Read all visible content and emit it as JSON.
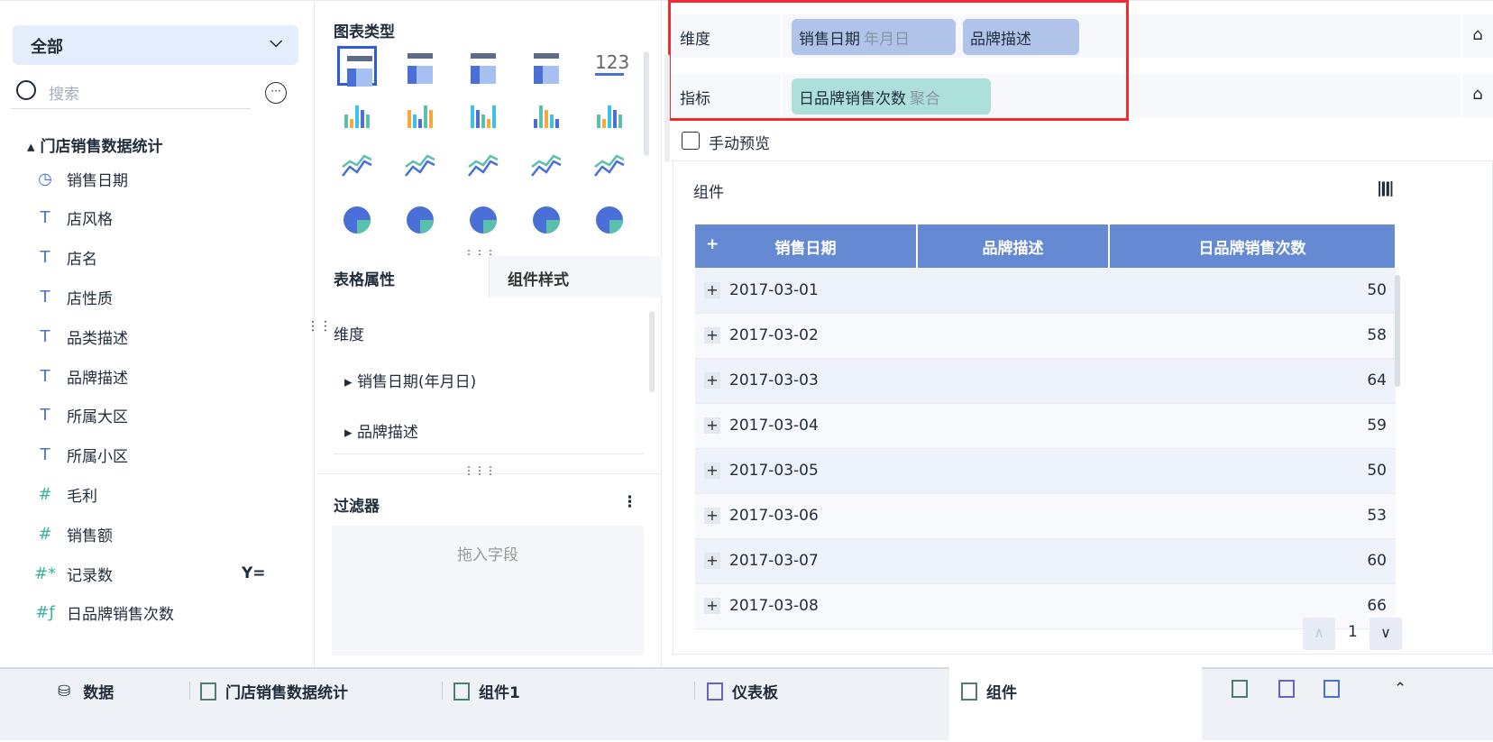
{
  "left": {
    "selector": "全部",
    "search_placeholder": "搜索",
    "dataset": "门店销售数据统计",
    "fields": [
      {
        "icon": "clock-icon",
        "g": "◷",
        "label": "销售日期"
      },
      {
        "icon": "text-icon",
        "g": "T",
        "label": "店风格"
      },
      {
        "icon": "text-icon",
        "g": "T",
        "label": "店名"
      },
      {
        "icon": "text-icon",
        "g": "T",
        "label": "店性质"
      },
      {
        "icon": "text-icon",
        "g": "T",
        "label": "品类描述"
      },
      {
        "icon": "text-icon",
        "g": "T",
        "label": "品牌描述"
      },
      {
        "icon": "text-icon",
        "g": "T",
        "label": "所属大区"
      },
      {
        "icon": "text-icon",
        "g": "T",
        "label": "所属小区"
      },
      {
        "icon": "number-icon",
        "g": "#",
        "label": "毛利"
      },
      {
        "icon": "number-icon",
        "g": "#",
        "label": "销售额"
      },
      {
        "icon": "computed-number-icon",
        "g": "#*",
        "label": "记录数"
      },
      {
        "icon": "formula-number-icon",
        "g": "#ƒ",
        "label": "日品牌销售次数"
      }
    ]
  },
  "mid": {
    "chart_types_title": "图表类型",
    "tab_props": "表格属性",
    "tab_style": "组件样式",
    "dimension": "维度",
    "dim_items": [
      "销售日期(年月日)",
      "品牌描述"
    ],
    "filter_title": "过滤器",
    "filter_drop": "拖入字段",
    "number_icon_text": "123"
  },
  "right": {
    "dimension_label": "维度",
    "measure_label": "指标",
    "dim_pills": [
      {
        "name": "销售日期",
        "sub": "年月日"
      },
      {
        "name": "品牌描述",
        "sub": ""
      }
    ],
    "measure_pills": [
      {
        "name": "日品牌销售次数",
        "sub": "聚合"
      }
    ],
    "manual_preview": "手动预览",
    "component_title": "组件",
    "table": {
      "headers": [
        "销售日期",
        "品牌描述",
        "日品牌销售次数"
      ],
      "rows": [
        [
          "2017-03-01",
          "",
          "50"
        ],
        [
          "2017-03-02",
          "",
          "58"
        ],
        [
          "2017-03-03",
          "",
          "64"
        ],
        [
          "2017-03-04",
          "",
          "59"
        ],
        [
          "2017-03-05",
          "",
          "50"
        ],
        [
          "2017-03-06",
          "",
          "53"
        ],
        [
          "2017-03-07",
          "",
          "60"
        ],
        [
          "2017-03-08",
          "",
          "66"
        ]
      ]
    },
    "page": "1"
  },
  "bottom": {
    "tabs": [
      "数据",
      "门店销售数据统计",
      "组件1",
      "仪表板",
      "组件"
    ],
    "active": "组件"
  },
  "colors": {
    "accent": "#6689d3",
    "dim_pill": "#afc4e8",
    "measure_pill": "#aee0db",
    "highlight": "#f32a2f"
  }
}
